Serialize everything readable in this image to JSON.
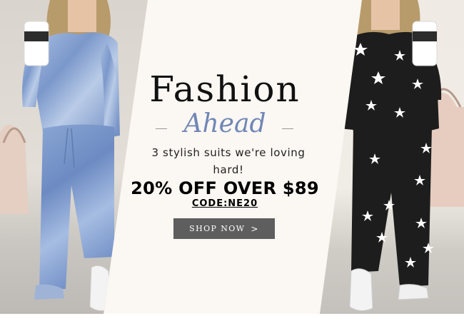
{
  "banner": {
    "headline": "Fashion",
    "subheadline": "Ahead",
    "tagline": "3 stylish suits we're loving hard!",
    "offer": "20% OFF OVER $89",
    "code": "CODE:NE20",
    "cta_label": "SHOP NOW",
    "cta_arrow": ">"
  },
  "colors": {
    "background": "#fbf7f2",
    "accent_text": "#6f86b7",
    "button": "#5e5e5e",
    "left_outfit": "#7f9bc9",
    "right_outfit": "#1d1d1d"
  },
  "images": {
    "left": "model-in-blue-tie-dye-lounge-suit-with-coffee-cup",
    "right": "model-in-black-star-print-lounge-suit-with-coffee-cup"
  }
}
